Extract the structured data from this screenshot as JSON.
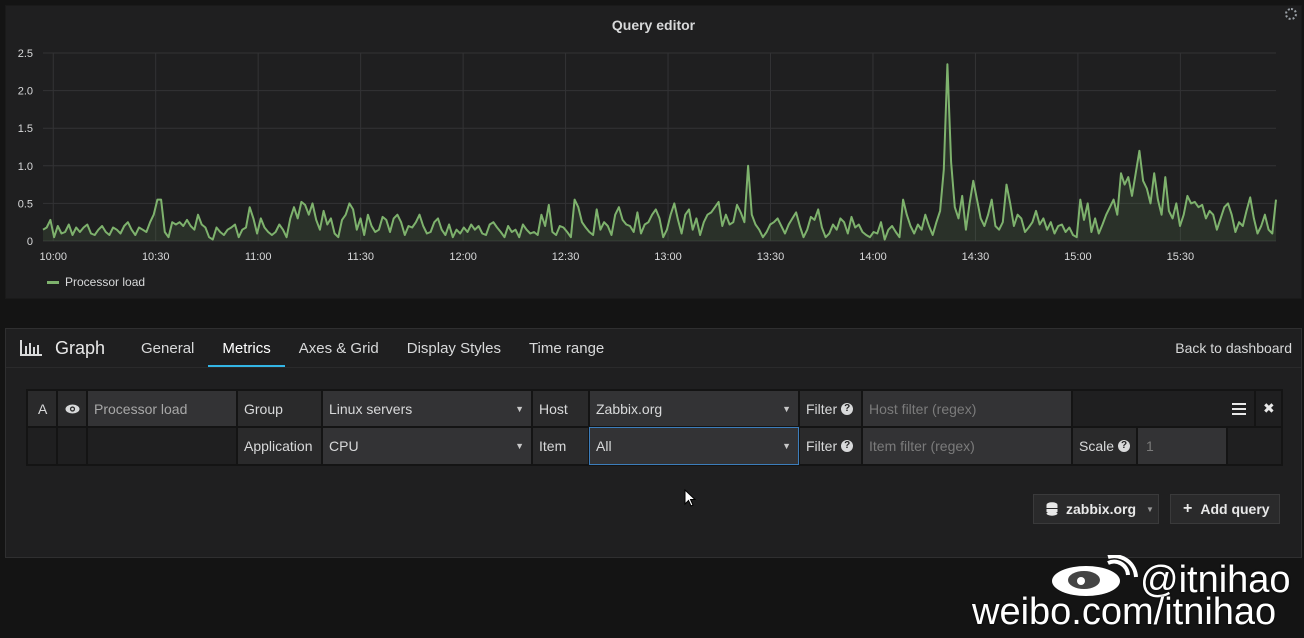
{
  "panel": {
    "title": "Query editor",
    "legend_label": "Processor load"
  },
  "chart_data": {
    "type": "area",
    "series": [
      {
        "name": "Processor load",
        "color": "#7eb26d",
        "values": [
          0.15,
          0.18,
          0.28,
          0.05,
          0.2,
          0.1,
          0.12,
          0.22,
          0.08,
          0.18,
          0.12,
          0.18,
          0.22,
          0.1,
          0.08,
          0.15,
          0.2,
          0.12,
          0.08,
          0.18,
          0.15,
          0.1,
          0.2,
          0.25,
          0.15,
          0.08,
          0.18,
          0.15,
          0.12,
          0.25,
          0.35,
          0.55,
          0.55,
          0.12,
          0.05,
          0.25,
          0.22,
          0.25,
          0.2,
          0.28,
          0.2,
          0.15,
          0.35,
          0.22,
          0.18,
          0.05,
          0.02,
          0.18,
          0.12,
          0.08,
          0.15,
          0.18,
          0.22,
          0.05,
          0.15,
          0.18,
          0.45,
          0.3,
          0.1,
          0.3,
          0.18,
          0.12,
          0.08,
          0.12,
          0.22,
          0.15,
          0.05,
          0.3,
          0.45,
          0.3,
          0.52,
          0.48,
          0.35,
          0.5,
          0.28,
          0.15,
          0.4,
          0.22,
          0.3,
          0.1,
          0.05,
          0.28,
          0.35,
          0.5,
          0.42,
          0.15,
          0.3,
          0.08,
          0.35,
          0.2,
          0.12,
          0.15,
          0.32,
          0.28,
          0.12,
          0.3,
          0.35,
          0.25,
          0.08,
          0.2,
          0.18,
          0.25,
          0.35,
          0.2,
          0.1,
          0.12,
          0.25,
          0.3,
          0.15,
          0.08,
          0.22,
          0.05,
          0.15,
          0.1,
          0.18,
          0.12,
          0.22,
          0.15,
          0.2,
          0.1,
          0.08,
          0.22,
          0.25,
          0.18,
          0.12,
          0.05,
          0.2,
          0.12,
          0.15,
          0.05,
          0.22,
          0.15,
          0.1,
          0.12,
          0.08,
          0.35,
          0.2,
          0.48,
          0.12,
          0.08,
          0.2,
          0.18,
          0.12,
          0.05,
          0.55,
          0.45,
          0.25,
          0.18,
          0.12,
          0.08,
          0.42,
          0.15,
          0.25,
          0.2,
          0.08,
          0.35,
          0.45,
          0.28,
          0.22,
          0.2,
          0.12,
          0.38,
          0.1,
          0.22,
          0.25,
          0.35,
          0.42,
          0.3,
          0.05,
          0.15,
          0.35,
          0.5,
          0.28,
          0.1,
          0.35,
          0.42,
          0.15,
          0.3,
          0.08,
          0.25,
          0.35,
          0.38,
          0.45,
          0.52,
          0.2,
          0.35,
          0.22,
          0.25,
          0.48,
          0.38,
          0.25,
          1.0,
          0.35,
          0.22,
          0.15,
          0.05,
          0.12,
          0.22,
          0.25,
          0.3,
          0.2,
          0.1,
          0.22,
          0.3,
          0.38,
          0.2,
          0.05,
          0.15,
          0.32,
          0.28,
          0.42,
          0.18,
          0.05,
          0.1,
          0.22,
          0.15,
          0.3,
          0.25,
          0.1,
          0.32,
          0.18,
          0.22,
          0.12,
          0.08,
          0.05,
          0.12,
          0.1,
          0.25,
          0.02,
          0.15,
          0.2,
          0.12,
          0.05,
          0.55,
          0.35,
          0.2,
          0.1,
          0.22,
          0.15,
          0.35,
          0.2,
          0.08,
          0.25,
          0.4,
          0.95,
          2.35,
          1.05,
          0.45,
          0.3,
          0.6,
          0.15,
          0.5,
          0.8,
          0.55,
          0.3,
          0.2,
          0.35,
          0.55,
          0.2,
          0.15,
          0.25,
          0.75,
          0.5,
          0.2,
          0.35,
          0.3,
          0.12,
          0.18,
          0.25,
          0.4,
          0.22,
          0.3,
          0.15,
          0.25,
          0.1,
          0.2,
          0.22,
          0.12,
          0.18,
          0.08,
          0.05,
          0.55,
          0.28,
          0.5,
          0.12,
          0.3,
          0.1,
          0.22,
          0.35,
          0.45,
          0.55,
          0.35,
          0.9,
          0.75,
          0.85,
          0.6,
          0.9,
          1.2,
          0.8,
          0.7,
          0.5,
          0.9,
          0.55,
          0.35,
          0.85,
          0.4,
          0.3,
          0.5,
          0.2,
          0.35,
          0.6,
          0.5,
          0.52,
          0.45,
          0.48,
          0.3,
          0.4,
          0.35,
          0.15,
          0.3,
          0.45,
          0.5,
          0.35,
          0.12,
          0.25,
          0.2,
          0.4,
          0.58,
          0.3,
          0.1,
          0.2,
          0.35,
          0.15,
          0.1,
          0.55
        ]
      }
    ],
    "x_ticks": [
      "10:00",
      "10:30",
      "11:00",
      "11:30",
      "12:00",
      "12:30",
      "13:00",
      "13:30",
      "14:00",
      "14:30",
      "15:00",
      "15:30"
    ],
    "y_ticks": [
      "0",
      "0.5",
      "1.0",
      "1.5",
      "2.0",
      "2.5"
    ],
    "ylim": [
      0,
      2.5
    ],
    "xlim_minutes": [
      -3,
      358
    ],
    "grid": true,
    "legend_position": "bottom-left"
  },
  "editor": {
    "title": "Graph",
    "tabs": [
      "General",
      "Metrics",
      "Axes & Grid",
      "Display Styles",
      "Time range"
    ],
    "active_tab": "Metrics",
    "back_link": "Back to dashboard"
  },
  "query": {
    "ref_id": "A",
    "alias": "Processor load",
    "group_label": "Group",
    "group_value": "Linux servers",
    "host_label": "Host",
    "host_value": "Zabbix.org",
    "filter_label": "Filter",
    "host_filter_placeholder": "Host filter (regex)",
    "application_label": "Application",
    "application_value": "CPU",
    "item_label": "Item",
    "item_value": "All",
    "item_filter_placeholder": "Item filter (regex)",
    "scale_label": "Scale",
    "scale_value": "1"
  },
  "buttons": {
    "datasource": "zabbix.org",
    "add_query": "Add query"
  },
  "watermark": {
    "handle": "@itnihao",
    "url": "weibo.com/itnihao"
  }
}
